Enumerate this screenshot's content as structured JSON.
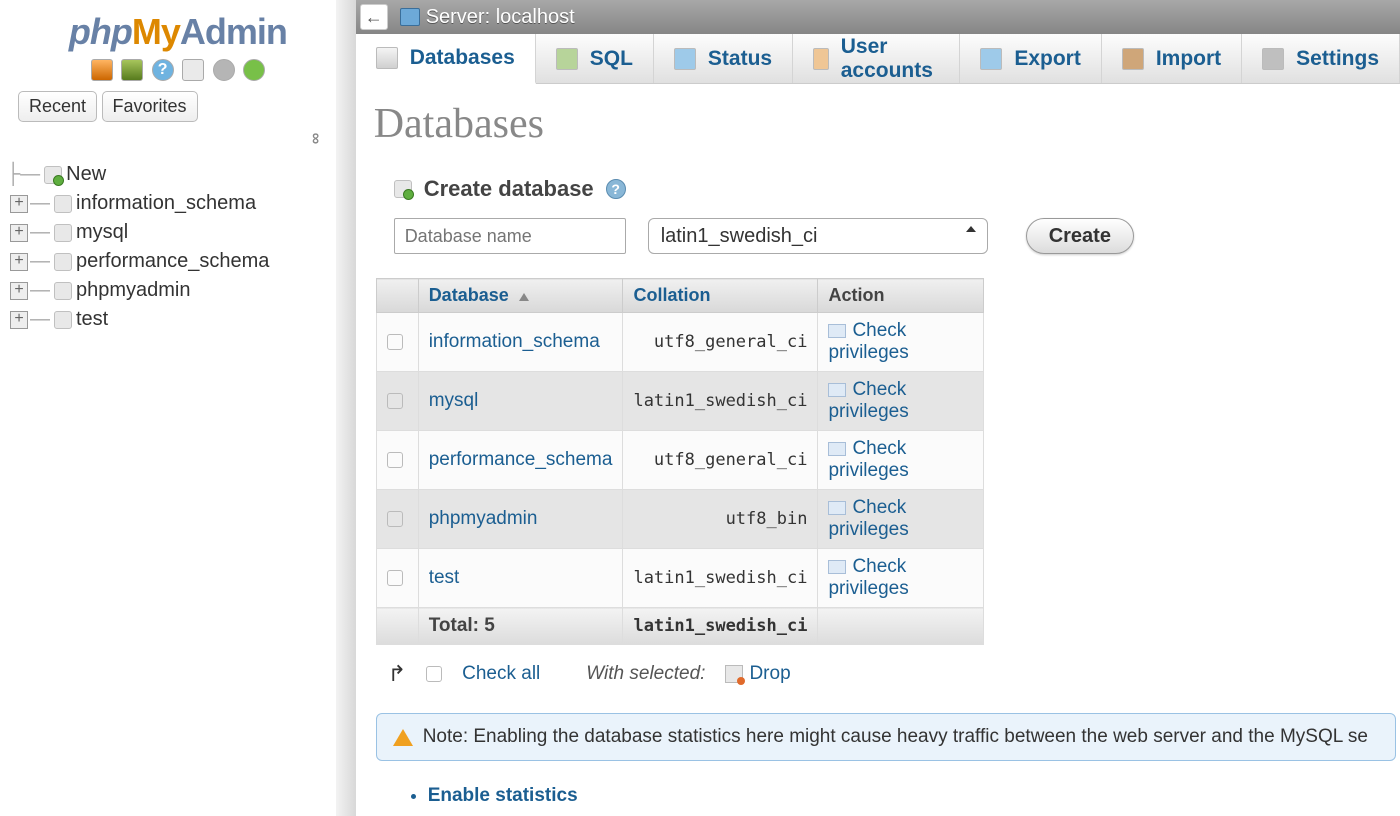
{
  "logo": {
    "p1": "php",
    "p2": "My",
    "p3": "Admin"
  },
  "sidebar": {
    "recent_label": "Recent",
    "favorites_label": "Favorites",
    "new_label": "New",
    "items": [
      {
        "name": "information_schema"
      },
      {
        "name": "mysql"
      },
      {
        "name": "performance_schema"
      },
      {
        "name": "phpmyadmin"
      },
      {
        "name": "test"
      }
    ]
  },
  "topbar": {
    "server_label": "Server: localhost"
  },
  "tabs": {
    "databases": "Databases",
    "sql": "SQL",
    "status": "Status",
    "users": "User accounts",
    "export": "Export",
    "import": "Import",
    "settings": "Settings"
  },
  "page": {
    "heading": "Databases",
    "create_label": "Create database",
    "dbname_placeholder": "Database name",
    "collation_selected": "latin1_swedish_ci",
    "create_btn": "Create"
  },
  "table": {
    "cols": {
      "db": "Database",
      "coll": "Collation",
      "act": "Action"
    },
    "rows": [
      {
        "db": "information_schema",
        "coll": "utf8_general_ci",
        "act": "Check privileges"
      },
      {
        "db": "mysql",
        "coll": "latin1_swedish_ci",
        "act": "Check privileges"
      },
      {
        "db": "performance_schema",
        "coll": "utf8_general_ci",
        "act": "Check privileges"
      },
      {
        "db": "phpmyadmin",
        "coll": "utf8_bin",
        "act": "Check privileges"
      },
      {
        "db": "test",
        "coll": "latin1_swedish_ci",
        "act": "Check privileges"
      }
    ],
    "total_label": "Total: 5",
    "total_coll": "latin1_swedish_ci"
  },
  "bulk": {
    "check_all": "Check all",
    "with_selected": "With selected:",
    "drop": "Drop"
  },
  "notice": "Note: Enabling the database statistics here might cause heavy traffic between the web server and the MySQL se",
  "enable_stats": "Enable statistics"
}
